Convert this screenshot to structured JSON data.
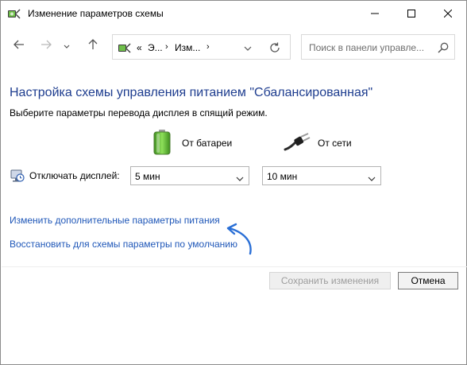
{
  "window": {
    "title": "Изменение параметров схемы",
    "icons": {
      "app": "power-options-icon",
      "minimize": "minimize-icon",
      "maximize": "maximize-icon",
      "close": "close-icon"
    }
  },
  "nav": {
    "back_icon": "arrow-left-icon",
    "forward_icon": "arrow-right-icon",
    "recent_icon": "chevron-down-icon",
    "up_icon": "arrow-up-icon",
    "address": {
      "overflow": "«",
      "crumb1": "Э...",
      "sep1": "›",
      "crumb2": "Изм...",
      "sep2": "›"
    },
    "refresh_icon": "refresh-icon",
    "search": {
      "placeholder": "Поиск в панели управле...",
      "icon": "search-icon"
    }
  },
  "content": {
    "heading": "Настройка схемы управления питанием \"Сбалансированная\"",
    "subtext": "Выберите параметры перевода дисплея в спящий режим.",
    "columns": {
      "battery": {
        "label": "От батареи",
        "icon": "battery-icon"
      },
      "plugged": {
        "label": "От сети",
        "icon": "power-plug-icon"
      }
    },
    "display_row": {
      "label": "Отключать дисплей:",
      "icon": "monitor-clock-icon",
      "battery_value": "5 мин",
      "plugged_value": "10 мин"
    },
    "links": {
      "advanced": "Изменить дополнительные параметры питания",
      "restore": "Восстановить для схемы параметры по умолчанию"
    }
  },
  "footer": {
    "save_label": "Сохранить изменения",
    "cancel_label": "Отмена"
  },
  "colors": {
    "heading": "#1e3d8f",
    "link": "#1f57b8",
    "annotation_arrow": "#2a6fd6"
  }
}
